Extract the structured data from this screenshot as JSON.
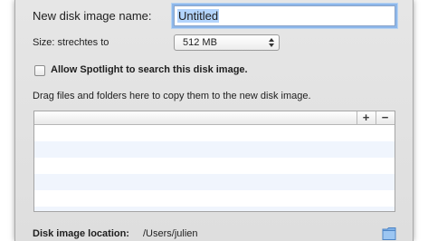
{
  "dialog": {
    "name_label": "New disk image name:",
    "name_value": "Untitled",
    "size_label": "Size: strechtes to",
    "size_value": "512 MB",
    "spotlight_label": "Allow Spotlight to search this disk image.",
    "spotlight_checked": false,
    "drag_hint": "Drag files and folders here to copy them to the new disk image.",
    "table": {
      "add_label": "+",
      "remove_label": "−",
      "rows": []
    },
    "location_label": "Disk image location:",
    "location_value": "/Users/julien"
  },
  "icons": [
    "select-arrows-icon",
    "folder-icon"
  ],
  "colors": {
    "focus_ring": "#8db7ea",
    "selection": "#b3d4fc",
    "row_stripe": "#f0f5fd",
    "sheet_bg": "#e2e2e2"
  }
}
